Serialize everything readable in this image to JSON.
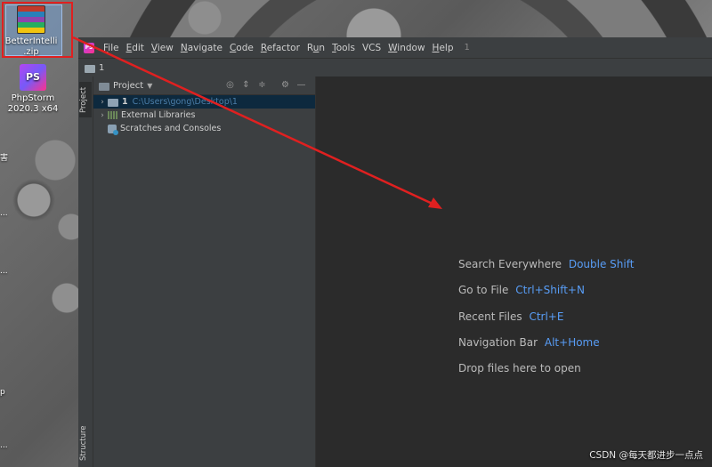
{
  "desktop": {
    "icons": [
      {
        "label": "BetterIntelli.zip",
        "line1": "BetterIntelli",
        "line2": ".zip",
        "icon": "winrar-archive-icon"
      },
      {
        "label": "PhpStorm 2020.3 x64",
        "line1": "PhpStorm",
        "line2": "2020.3 x64",
        "icon": "phpstorm-icon",
        "glyph_text": "PS"
      }
    ],
    "side_chars": [
      "害",
      "...",
      "...",
      "p",
      "..."
    ]
  },
  "ide": {
    "menu": [
      "File",
      "Edit",
      "View",
      "Navigate",
      "Code",
      "Refactor",
      "Run",
      "Tools",
      "VCS",
      "Window",
      "Help"
    ],
    "menu_underline": [
      "F",
      "E",
      "V",
      "N",
      "C",
      "R",
      "u",
      "T",
      "",
      "W",
      "H"
    ],
    "menu_trailing": "1",
    "breadcrumb": "1",
    "tool_tabs": {
      "project": "Project",
      "structure": "Structure"
    },
    "project_panel": {
      "title": "Project",
      "tree": [
        {
          "label": "1",
          "path": "C:\\Users\\gong\\Desktop\\1"
        },
        {
          "label": "External Libraries"
        },
        {
          "label": "Scratches and Consoles"
        }
      ]
    },
    "hints": [
      {
        "label": "Search Everywhere",
        "key": "Double Shift"
      },
      {
        "label": "Go to File",
        "key": "Ctrl+Shift+N"
      },
      {
        "label": "Recent Files",
        "key": "Ctrl+E"
      },
      {
        "label": "Navigation Bar",
        "key": "Alt+Home"
      },
      {
        "label": "Drop files here to open",
        "key": ""
      }
    ]
  },
  "annotation": {
    "color": "#e02020"
  },
  "colors": {
    "accent": "#589df6",
    "ide_bg": "#2b2b2b",
    "panel_bg": "#3c3f41"
  },
  "watermark": "CSDN @每天都进步一点点"
}
